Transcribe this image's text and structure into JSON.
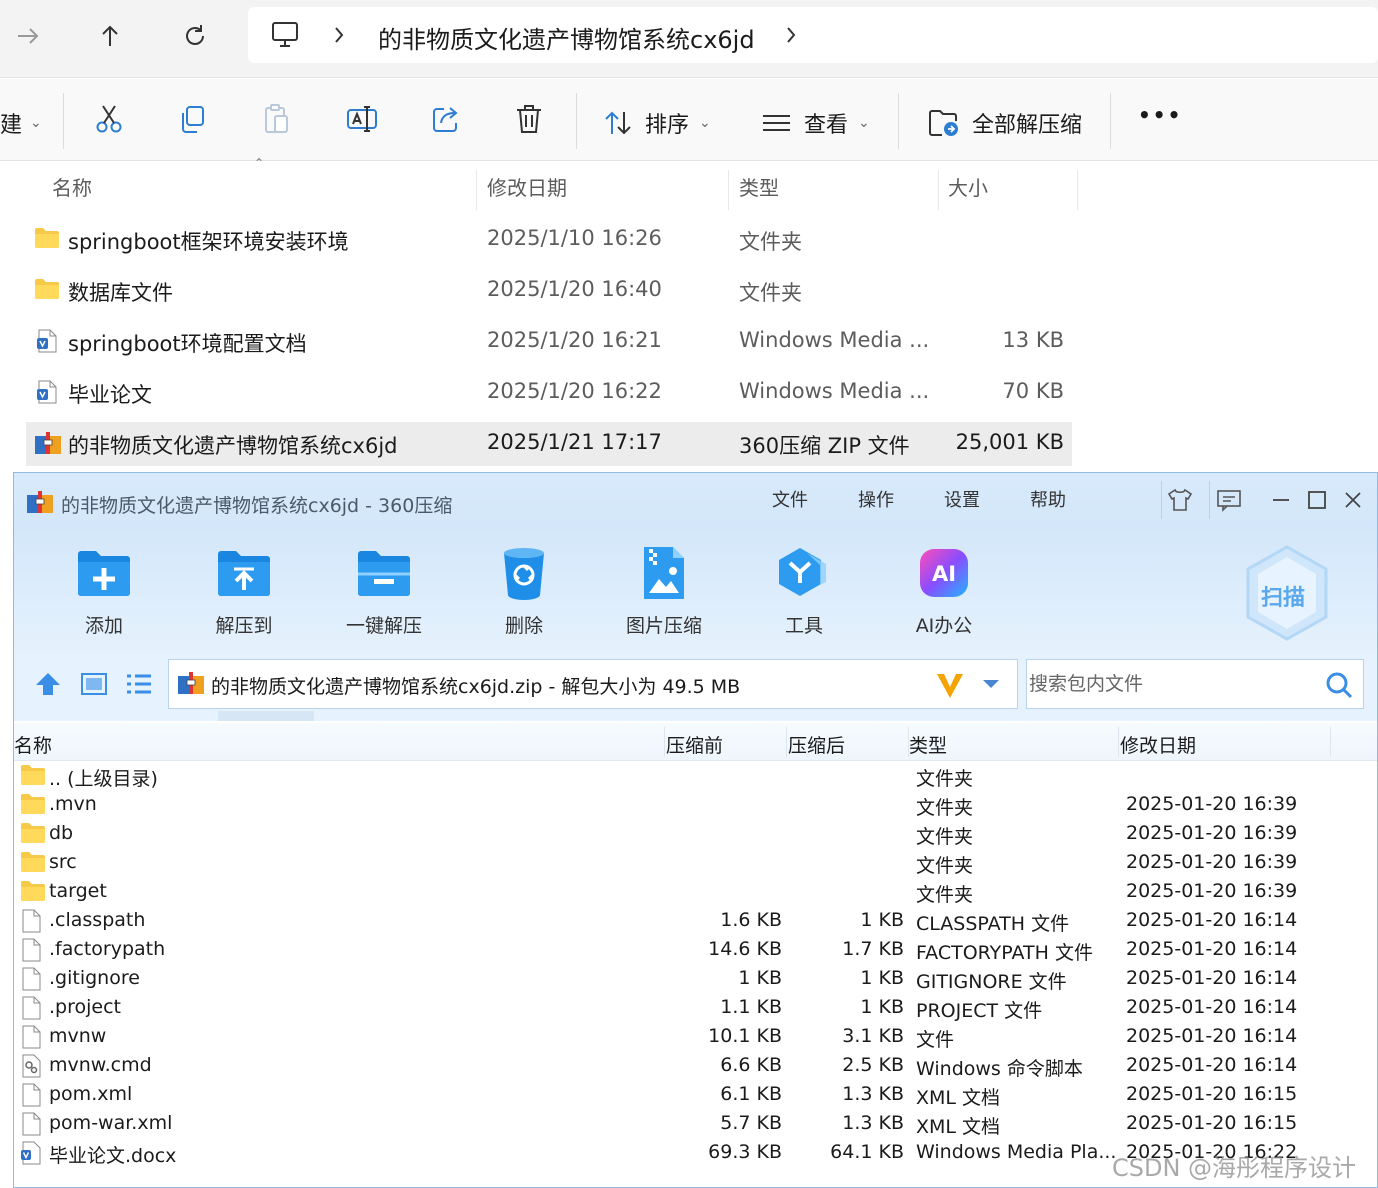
{
  "explorer": {
    "address": {
      "crumb": "的非物质文化遗产博物馆系统cx6jd"
    },
    "toolbar": {
      "new_label": "建",
      "sort_label": "排序",
      "view_label": "查看",
      "extract_all_label": "全部解压缩",
      "more_label": "•••"
    },
    "columns": {
      "name": "名称",
      "date": "修改日期",
      "type": "类型",
      "size": "大小"
    },
    "rows": [
      {
        "name": "springboot框架环境安装环境",
        "date": "2025/1/10 16:26",
        "type": "文件夹",
        "size": "",
        "icon": "folder-icon"
      },
      {
        "name": "数据库文件",
        "date": "2025/1/20 16:40",
        "type": "文件夹",
        "size": "",
        "icon": "folder-icon"
      },
      {
        "name": "springboot环境配置文档",
        "date": "2025/1/20 16:21",
        "type": "Windows Media ...",
        "size": "13 KB",
        "icon": "document-icon"
      },
      {
        "name": "毕业论文",
        "date": "2025/1/20 16:22",
        "type": "Windows Media ...",
        "size": "70 KB",
        "icon": "document-icon"
      },
      {
        "name": "的非物质文化遗产博物馆系统cx6jd",
        "date": "2025/1/21 17:17",
        "type": "360压缩 ZIP 文件",
        "size": "25,001 KB",
        "icon": "zip-archive-icon",
        "selected": true
      }
    ]
  },
  "zip_window": {
    "title": "的非物质文化遗产博物馆系统cx6jd - 360压缩",
    "menu": [
      "文件",
      "操作",
      "设置",
      "帮助"
    ],
    "ribbon": [
      {
        "label": "添加",
        "icon": "add-folder-icon"
      },
      {
        "label": "解压到",
        "icon": "extract-to-folder-icon"
      },
      {
        "label": "一键解压",
        "icon": "one-click-extract-icon"
      },
      {
        "label": "删除",
        "icon": "recycle-bin-icon"
      },
      {
        "label": "图片压缩",
        "icon": "image-compress-icon"
      },
      {
        "label": "工具",
        "icon": "tools-icon"
      },
      {
        "label": "AI办公",
        "icon": "ai-office-icon"
      }
    ],
    "scan_label": "扫描",
    "path": "的非物质文化遗产博物馆系统cx6jd.zip - 解包大小为 49.5 MB",
    "search_placeholder": "搜索包内文件",
    "columns": {
      "name": "名称",
      "before": "压缩前",
      "after": "压缩后",
      "type": "类型",
      "date": "修改日期"
    },
    "rows": [
      {
        "name": ".. (上级目录)",
        "before": "",
        "after": "",
        "type": "文件夹",
        "date": "",
        "icon": "folder-icon"
      },
      {
        "name": ".mvn",
        "before": "",
        "after": "",
        "type": "文件夹",
        "date": "2025-01-20 16:39",
        "icon": "folder-icon"
      },
      {
        "name": "db",
        "before": "",
        "after": "",
        "type": "文件夹",
        "date": "2025-01-20 16:39",
        "icon": "folder-icon"
      },
      {
        "name": "src",
        "before": "",
        "after": "",
        "type": "文件夹",
        "date": "2025-01-20 16:39",
        "icon": "folder-icon"
      },
      {
        "name": "target",
        "before": "",
        "after": "",
        "type": "文件夹",
        "date": "2025-01-20 16:39",
        "icon": "folder-icon"
      },
      {
        "name": ".classpath",
        "before": "1.6 KB",
        "after": "1 KB",
        "type": "CLASSPATH 文件",
        "date": "2025-01-20 16:14",
        "icon": "file-icon"
      },
      {
        "name": ".factorypath",
        "before": "14.6 KB",
        "after": "1.7 KB",
        "type": "FACTORYPATH 文件",
        "date": "2025-01-20 16:14",
        "icon": "file-icon"
      },
      {
        "name": ".gitignore",
        "before": "1 KB",
        "after": "1 KB",
        "type": "GITIGNORE 文件",
        "date": "2025-01-20 16:14",
        "icon": "file-icon"
      },
      {
        "name": ".project",
        "before": "1.1 KB",
        "after": "1 KB",
        "type": "PROJECT 文件",
        "date": "2025-01-20 16:14",
        "icon": "file-icon"
      },
      {
        "name": "mvnw",
        "before": "10.1 KB",
        "after": "3.1 KB",
        "type": "文件",
        "date": "2025-01-20 16:14",
        "icon": "file-icon"
      },
      {
        "name": "mvnw.cmd",
        "before": "6.6 KB",
        "after": "2.5 KB",
        "type": "Windows 命令脚本",
        "date": "2025-01-20 16:14",
        "icon": "cmd-script-icon"
      },
      {
        "name": "pom.xml",
        "before": "6.1 KB",
        "after": "1.3 KB",
        "type": "XML 文档",
        "date": "2025-01-20 16:15",
        "icon": "file-icon"
      },
      {
        "name": "pom-war.xml",
        "before": "5.7 KB",
        "after": "1.3 KB",
        "type": "XML 文档",
        "date": "2025-01-20 16:15",
        "icon": "file-icon"
      },
      {
        "name": "毕业论文.docx",
        "before": "69.3 KB",
        "after": "64.1 KB",
        "type": "Windows Media Pla...",
        "date": "2025-01-20 16:22",
        "icon": "document-icon"
      }
    ]
  },
  "watermark": "CSDN @海彤程序设计",
  "colors": {
    "folder": "#f7c948",
    "accent_blue": "#1e88e5",
    "zip_title_bg": "#d8eafb"
  }
}
